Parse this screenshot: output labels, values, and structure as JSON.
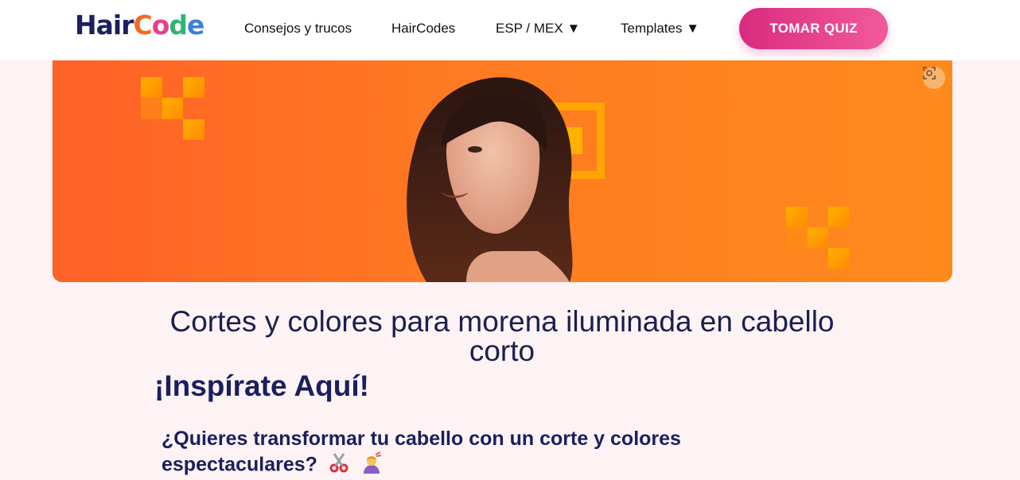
{
  "header": {
    "logo_parts": [
      "Hair",
      "C",
      "o",
      "d",
      "e"
    ],
    "nav": [
      {
        "label": "Consejos y trucos"
      },
      {
        "label": "HairCodes"
      },
      {
        "label": "ESP / MEX ▼"
      },
      {
        "label": "Templates ▼"
      }
    ],
    "cta_label": "TOMAR QUIZ"
  },
  "hero": {
    "image_description_icon": "lens-scan-icon"
  },
  "content": {
    "title": "Cortes y colores para morena iluminada en cabello corto",
    "subtitle": "¡Inspírate Aquí!",
    "question": "¿Quieres transformar tu cabello con un corte y colores espectaculares?"
  },
  "colors": {
    "brand_navy": "#1b1f5e",
    "cta_pink": "#d92b80",
    "hero_orange": "#ff7a22",
    "page_bg": "#fdf3f4"
  }
}
